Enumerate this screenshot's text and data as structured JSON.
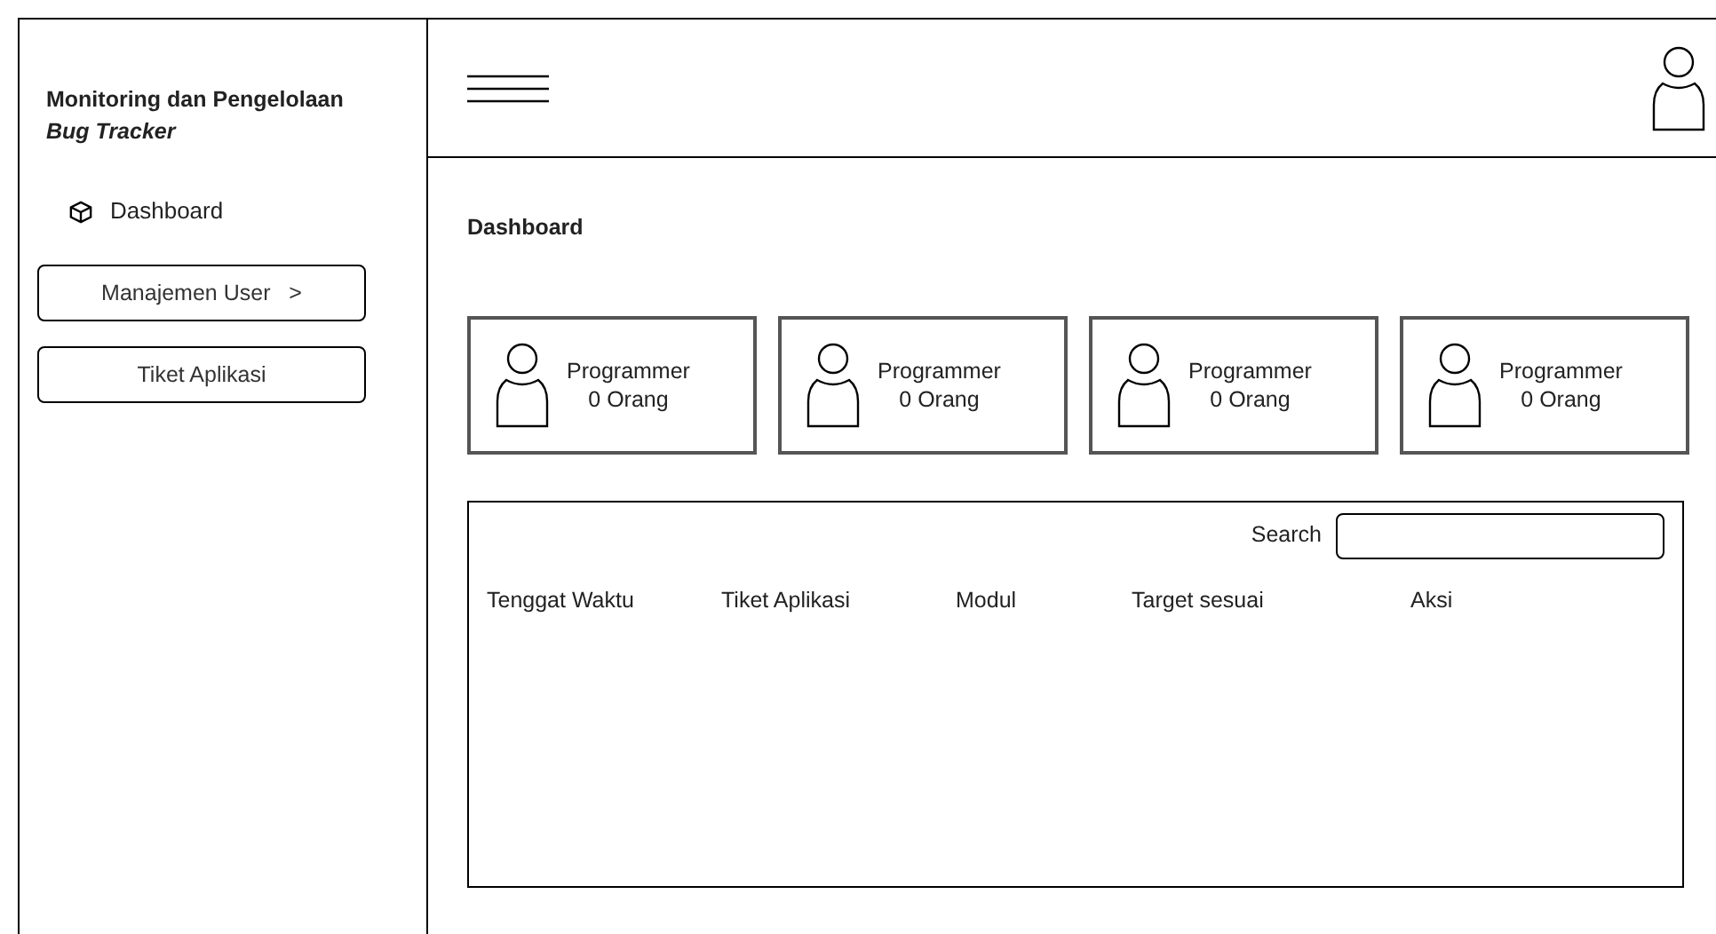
{
  "sidebar": {
    "title": "Monitoring dan Pengelolaan",
    "subtitle": "Bug Tracker",
    "items": [
      {
        "kind": "link",
        "label": "Dashboard"
      },
      {
        "kind": "button",
        "label": "Manajemen User   >"
      },
      {
        "kind": "button",
        "label": "Tiket Aplikasi"
      }
    ]
  },
  "page": {
    "heading": "Dashboard"
  },
  "cards": [
    {
      "label": "Programmer",
      "count": "0 Orang"
    },
    {
      "label": "Programmer",
      "count": "0 Orang"
    },
    {
      "label": "Programmer",
      "count": "0 Orang"
    },
    {
      "label": "Programmer",
      "count": "0 Orang"
    }
  ],
  "table": {
    "search_label": "Search",
    "columns": [
      "Tenggat Waktu",
      "Tiket Aplikasi",
      "Modul",
      "Target sesuai",
      "Aksi"
    ]
  }
}
